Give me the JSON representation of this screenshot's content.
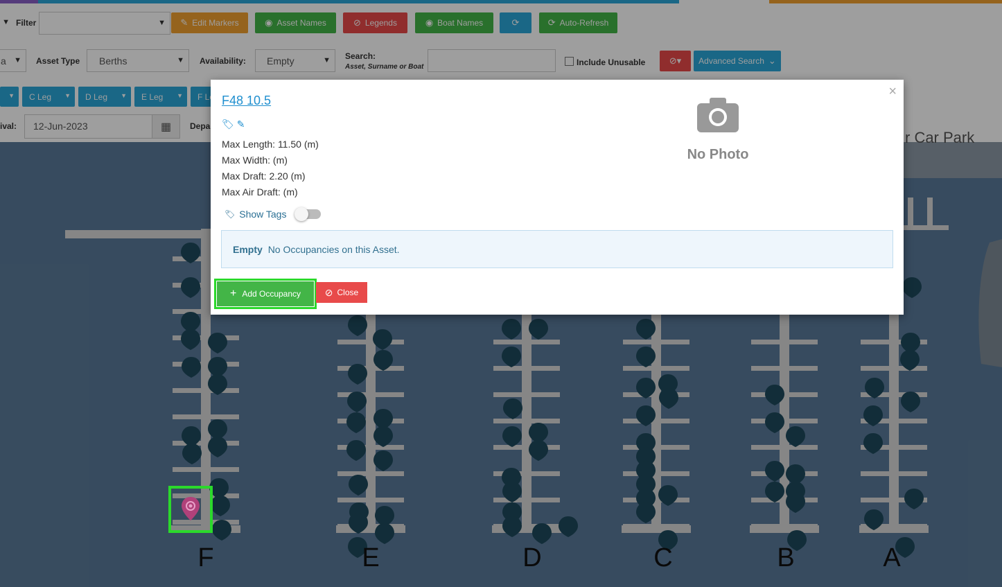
{
  "toolbar": {
    "filter_label": "Filter",
    "filter_value": "",
    "edit_markers": "Edit Markers",
    "asset_names": "Asset Names",
    "legends": "Legends",
    "boat_names": "Boat Names",
    "auto_refresh": "Auto-Refresh",
    "row2_partial_select": "a",
    "asset_type_label": "Asset Type",
    "asset_type_value": "Berths",
    "availability_label": "Availability:",
    "availability_value": "Empty",
    "search_label": "Search:",
    "search_sub": "Asset, Surname or Boat",
    "include_unusable": "Include Unusable",
    "advanced_search": "Advanced Search",
    "legs": [
      "",
      "C Leg",
      "D Leg",
      "E Leg",
      "F Le"
    ],
    "arrival_label": "ival:",
    "arrival_value": "12-Jun-2023",
    "departure_label": "Depa"
  },
  "map": {
    "carpark_label": "r Car Park",
    "pontoon_labels": [
      "F",
      "E",
      "D",
      "C",
      "B",
      "A"
    ]
  },
  "modal": {
    "title": "F48 10.5",
    "max_length": "Max Length: 11.50 (m)",
    "max_width": "Max Width: (m)",
    "max_draft": "Max Draft: 2.20 (m)",
    "max_air_draft": "Max Air Draft: (m)",
    "show_tags": "Show Tags",
    "notice_strong": "Empty",
    "notice_text": "No Occupancies on this Asset.",
    "add_occupancy": "Add Occupancy",
    "close": "Close",
    "close_x": "×",
    "no_photo": "No Photo"
  },
  "colors": {
    "map_bg": "#5a7a99",
    "marker": "#1e4a5c",
    "selected_marker": "#b0417a",
    "green_btn": "#43b547",
    "red_btn": "#e84a4a",
    "blue_btn": "#2aa7d8",
    "orange_btn": "#f0a030"
  }
}
